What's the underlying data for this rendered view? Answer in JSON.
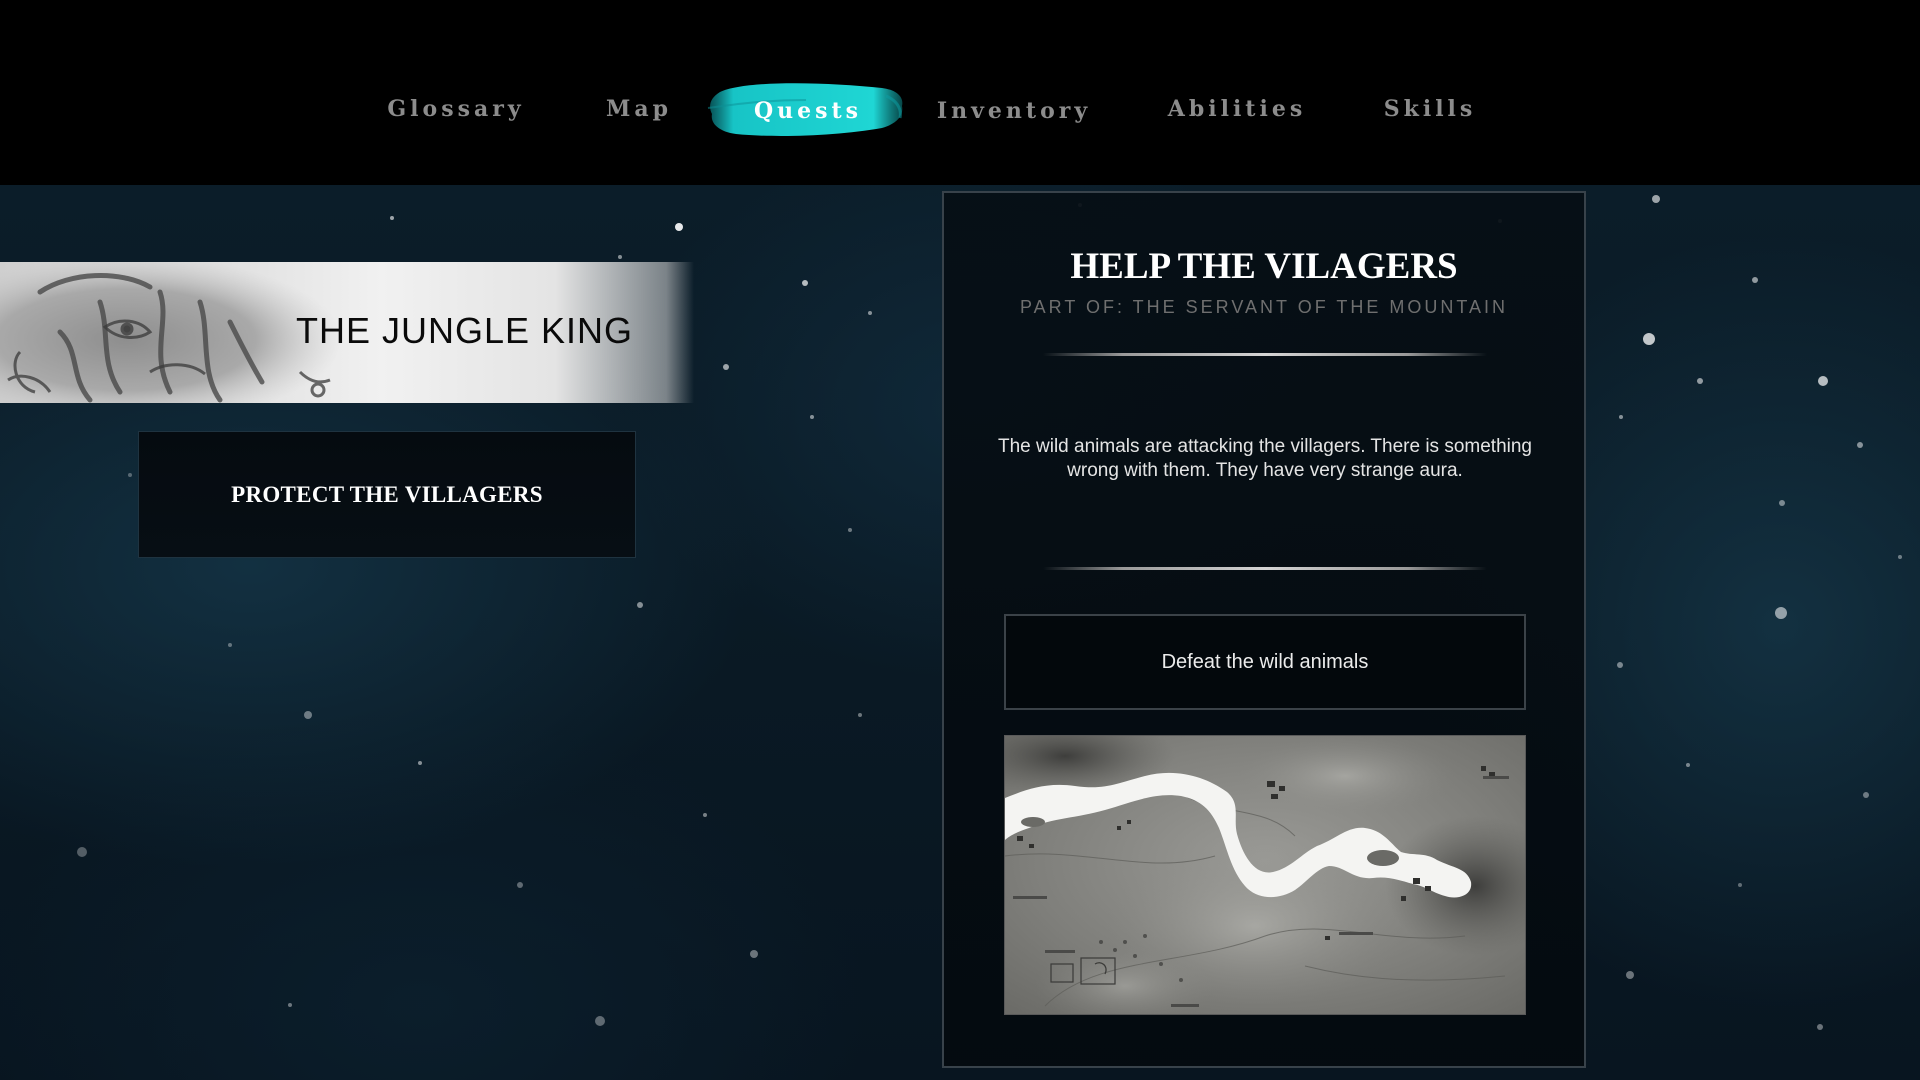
{
  "nav": {
    "tabs": [
      {
        "label": "Glossary"
      },
      {
        "label": "Map"
      },
      {
        "label": "Quests"
      },
      {
        "label": "Inventory"
      },
      {
        "label": "Abilities"
      },
      {
        "label": "Skills"
      }
    ],
    "active_tab": "Quests",
    "accent_color": "#15c9cb"
  },
  "quest_list": {
    "group_title": "THE JUNGLE KING",
    "group_icon": "tiger-sketch-icon",
    "quests": [
      {
        "label": "PROTECT THE VILLAGERS"
      }
    ]
  },
  "quest_detail": {
    "title": "HELP THE VILAGERS",
    "subtitle": "PART OF: THE SERVANT OF THE MOUNTAIN",
    "description": "The wild animals are attacking the villagers. There is something wrong with them. They have very strange aura.",
    "objective": "Defeat the wild animals",
    "map_image": "river-map-thumbnail"
  }
}
